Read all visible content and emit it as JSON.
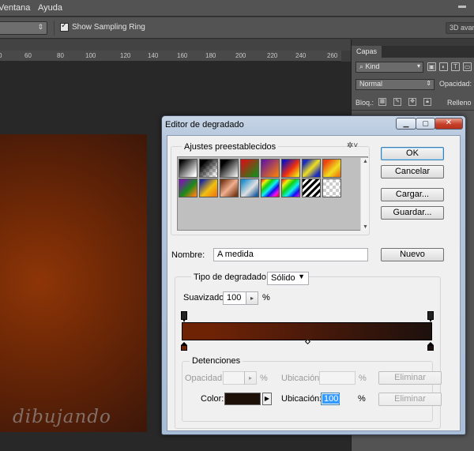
{
  "menubar": {
    "items": [
      "Ventana",
      "Ayuda"
    ]
  },
  "options_bar": {
    "sampling_ring_label": "Show Sampling Ring",
    "sampling_ring_checked": true,
    "right_button": "3D avanz"
  },
  "ruler": {
    "ticks": [
      "0",
      "60",
      "80",
      "100",
      "120",
      "140",
      "160",
      "180",
      "200",
      "220",
      "240",
      "260"
    ]
  },
  "layers_panel": {
    "tab": "Capas",
    "kind_filter": "Kind",
    "blend_mode": "Normal",
    "opacity_label": "Opacidad:",
    "lock_label": "Bloq.:",
    "fill_label": "Relleno"
  },
  "watermark": "dibujando",
  "dialog": {
    "title": "Editor de degradado",
    "window_buttons": {
      "minimize": "▁",
      "maximize": "▢",
      "close": "✕"
    },
    "presets": {
      "legend": "Ajustes preestablecidos",
      "swatches_row1": [
        "linear-gradient(135deg,#000 10%,#fff 90%)",
        "linear-gradient(135deg,#000 0%,#000 20%,transparent 90%),repeating-conic-gradient(#ccc 0 25%,#fff 0 50%) 0 0/8px 8px",
        "linear-gradient(135deg,#000 20%,#fff 100%)",
        "linear-gradient(135deg,#d01414 10%,#1a8a1a 90%)",
        "linear-gradient(135deg,#6a1a9a 10%,#f07a10 90%)",
        "linear-gradient(135deg,#1010c0 10%,#f03010 55%,#f0e010 90%)",
        "linear-gradient(135deg,#1a2bc0 15%,#f0e020 50%,#1a2bc0 85%)",
        "linear-gradient(135deg,#f04010 15%,#f0e020 60%,#f08010 90%)"
      ],
      "swatches_row2": [
        "linear-gradient(135deg,#7a1ab0 10%,#1a8a1a 55%,#f08010 90%)",
        "linear-gradient(135deg,#1a2aa0 10%,#f0c010 55%,#f08010 90%)",
        "linear-gradient(135deg,#7a3a1a 10%,#f0b090 50%,#7a3a1a 90%)",
        "linear-gradient(135deg,#2090d0 10%,#e0e0e0 55%,#2060a0 90%)",
        "linear-gradient(135deg,#f01010,#f0f010,#10d010,#10f0f0,#1010f0,#f010f0,#f01010)",
        "linear-gradient(135deg,#f01010,#f0f010,#10d010,#10f0f0,#1010f0,#f010f0) ",
        "repeating-linear-gradient(135deg,#000 0 3px,#fff 3px 6px)",
        "repeating-conic-gradient(#ccc 0 25%,#fff 0 50%) 0 0/8px 8px"
      ]
    },
    "buttons": {
      "ok": "OK",
      "cancel": "Cancelar",
      "load": "Cargar...",
      "save": "Guardar...",
      "new": "Nuevo"
    },
    "name_label": "Nombre:",
    "name_value": "A medida",
    "gradient_type_label": "Tipo de degradado:",
    "gradient_type_value": "Sólido",
    "smoothness_label": "Suavizado:",
    "smoothness_value": "100",
    "smoothness_unit": "%",
    "stops": {
      "legend": "Detenciones",
      "opacity_label": "Opacidad:",
      "opacity_unit": "%",
      "opacity_location_label": "Ubicación:",
      "opacity_location_unit": "%",
      "delete_label": "Eliminar",
      "color_label": "Color:",
      "color_value": "#1d1009",
      "color_location_label": "Ubicación:",
      "color_location_value": "100",
      "color_location_unit": "%"
    },
    "gradient_colors": [
      "#6e2305",
      "#1d100c"
    ]
  }
}
